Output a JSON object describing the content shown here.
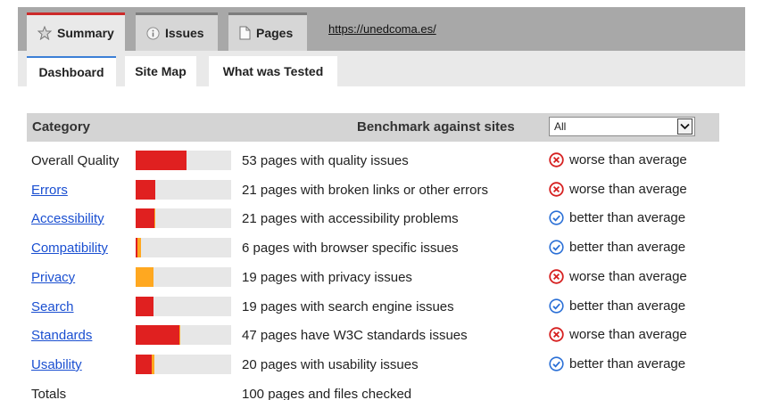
{
  "tabs": {
    "summary": "Summary",
    "issues": "Issues",
    "pages": "Pages",
    "url": "https://unedcoma.es/"
  },
  "subtabs": {
    "dashboard": "Dashboard",
    "site_map": "Site Map",
    "what_tested": "What was Tested"
  },
  "table": {
    "header_category": "Category",
    "header_benchmark": "Benchmark against sites",
    "benchmark_value": "All",
    "rows": [
      {
        "category": "Overall Quality",
        "description": "53 pages with quality issues",
        "status": "worse than average",
        "red_fraction": 0.53,
        "orange_fraction": 0.0
      },
      {
        "category": "Errors",
        "description": "21 pages with broken links or other errors",
        "status": "worse than average",
        "red_fraction": 0.21,
        "orange_fraction": 0.0
      },
      {
        "category": "Accessibility",
        "description": "21 pages with accessibility problems",
        "status": "better than average",
        "red_fraction": 0.2,
        "orange_fraction": 0.01
      },
      {
        "category": "Compatibility",
        "description": "6 pages with browser specific issues",
        "status": "better than average",
        "red_fraction": 0.02,
        "orange_fraction": 0.04
      },
      {
        "category": "Privacy",
        "description": "19 pages with privacy issues",
        "status": "worse than average",
        "red_fraction": 0.0,
        "orange_fraction": 0.19
      },
      {
        "category": "Search",
        "description": "19 pages with search engine issues",
        "status": "better than average",
        "red_fraction": 0.19,
        "orange_fraction": 0.0
      },
      {
        "category": "Standards",
        "description": "47 pages have W3C standards issues",
        "status": "worse than average",
        "red_fraction": 0.46,
        "orange_fraction": 0.01
      },
      {
        "category": "Usability",
        "description": "20 pages with usability issues",
        "status": "better than average",
        "red_fraction": 0.17,
        "orange_fraction": 0.03
      }
    ],
    "totals_label": "Totals",
    "totals_description": "100 pages and files checked"
  },
  "colors": {
    "red": "#e02020",
    "orange": "#ffa820",
    "worse_icon": "#d62020",
    "better_icon": "#2a6fd6",
    "active_tab_accent": "#cc2a2a",
    "active_subtab_accent": "#3c7fd6"
  },
  "icons": {
    "summary": "star-icon",
    "issues": "info-icon",
    "pages": "page-icon",
    "worse": "x-circle-icon",
    "better": "check-circle-icon",
    "dropdown": "chevron-down-icon"
  }
}
